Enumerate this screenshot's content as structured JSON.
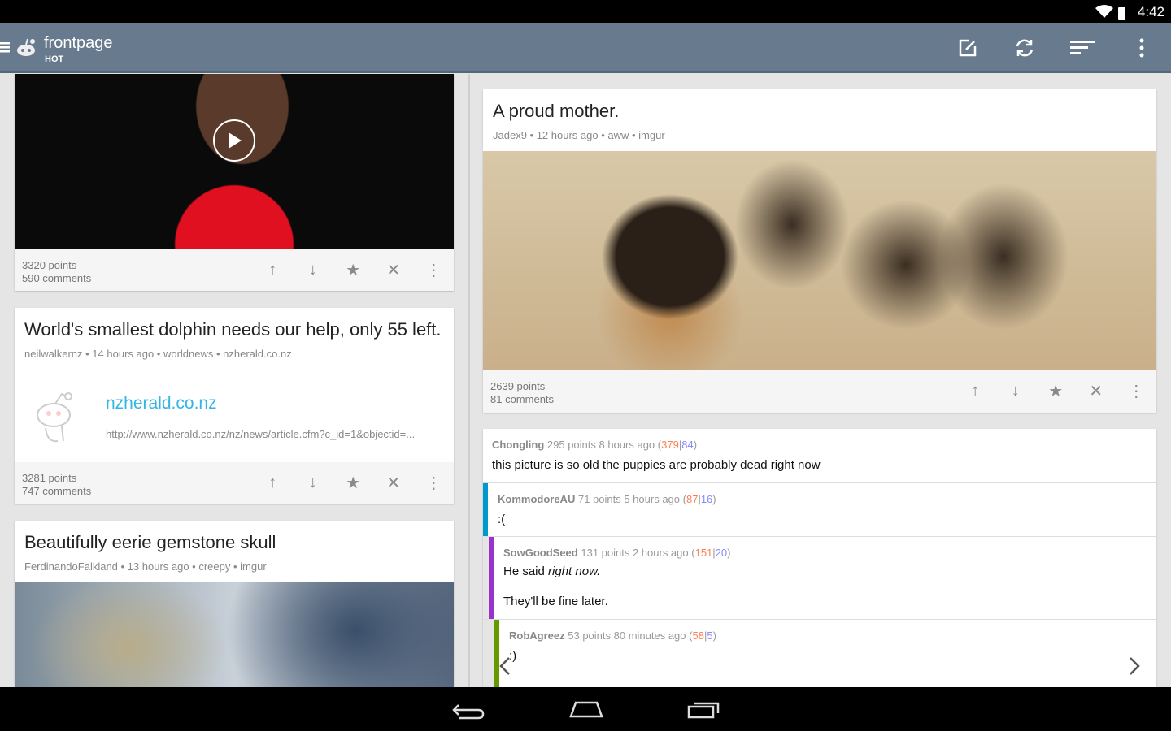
{
  "status": {
    "time": "4:42"
  },
  "toolbar": {
    "title": "frontpage",
    "subtitle": "HOT"
  },
  "left": [
    {
      "points": "3320 points",
      "comments": "590 comments"
    },
    {
      "title": "World's smallest dolphin needs our help, only 55 left.",
      "meta": "neilwalkernz • 14 hours ago • worldnews • nzherald.co.nz",
      "link_domain": "nzherald.co.nz",
      "link_url": "http://www.nzherald.co.nz/nz/news/article.cfm?c_id=1&objectid=...",
      "points": "3281 points",
      "comments": "747 comments"
    },
    {
      "title": "Beautifully eerie gemstone skull",
      "meta": "FerdinandoFalkland • 13 hours ago • creepy • imgur"
    }
  ],
  "right": {
    "title": "A proud mother.",
    "meta": "Jadex9 • 12 hours ago • aww • imgur",
    "points": "2639 points",
    "comments": "81 comments"
  },
  "comments": [
    {
      "author": "Chongling",
      "info": "295 points 8 hours ago",
      "up": "379",
      "down": "84",
      "body": "this picture is so old the puppies are probably dead right now",
      "color": ""
    },
    {
      "author": "KommodoreAU",
      "info": "71 points 5 hours ago",
      "up": "87",
      "down": "16",
      "body": ":(",
      "color": "#0099cc"
    },
    {
      "author": "SowGoodSeed",
      "info": "131 points 2 hours ago",
      "up": "151",
      "down": "20",
      "body1": "He said ",
      "body_em": "right now.",
      "body2": "They'll be fine later.",
      "color": "#9933cc"
    },
    {
      "author": "RobAgreez",
      "info": "53 points 80 minutes ago",
      "up": "58",
      "down": "5",
      "body": ":)",
      "color": "#669900"
    }
  ]
}
